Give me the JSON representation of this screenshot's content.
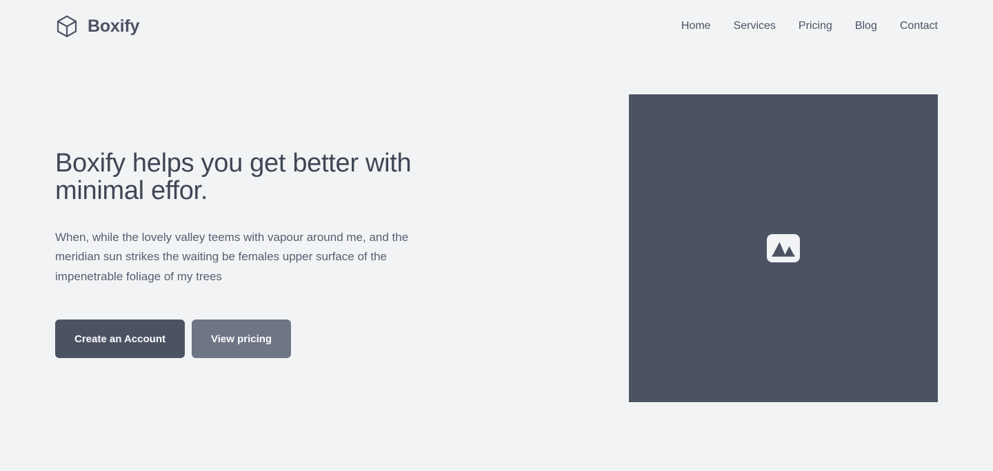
{
  "header": {
    "brand": {
      "name": "Boxify",
      "icon": "cube-icon"
    },
    "nav": [
      {
        "label": "Home"
      },
      {
        "label": "Services"
      },
      {
        "label": "Pricing"
      },
      {
        "label": "Blog"
      },
      {
        "label": "Contact"
      }
    ]
  },
  "hero": {
    "title": "Boxify helps you get better with minimal effor.",
    "subtitle": "When, while the lovely valley teems with vapour around me, and the meridian sun strikes the waiting be females upper surface of the impenetrable foliage of my trees",
    "primary_cta": "Create an Account",
    "secondary_cta": "View pricing",
    "media": {
      "icon": "image-placeholder-icon"
    }
  },
  "colors": {
    "page_background": "#f2f3f5",
    "slate": "#4b5363",
    "slate_light": "#6e7585",
    "text_body": "#565e6e",
    "heading": "#3f4654",
    "placeholder_tile": "#f1f3f5"
  }
}
